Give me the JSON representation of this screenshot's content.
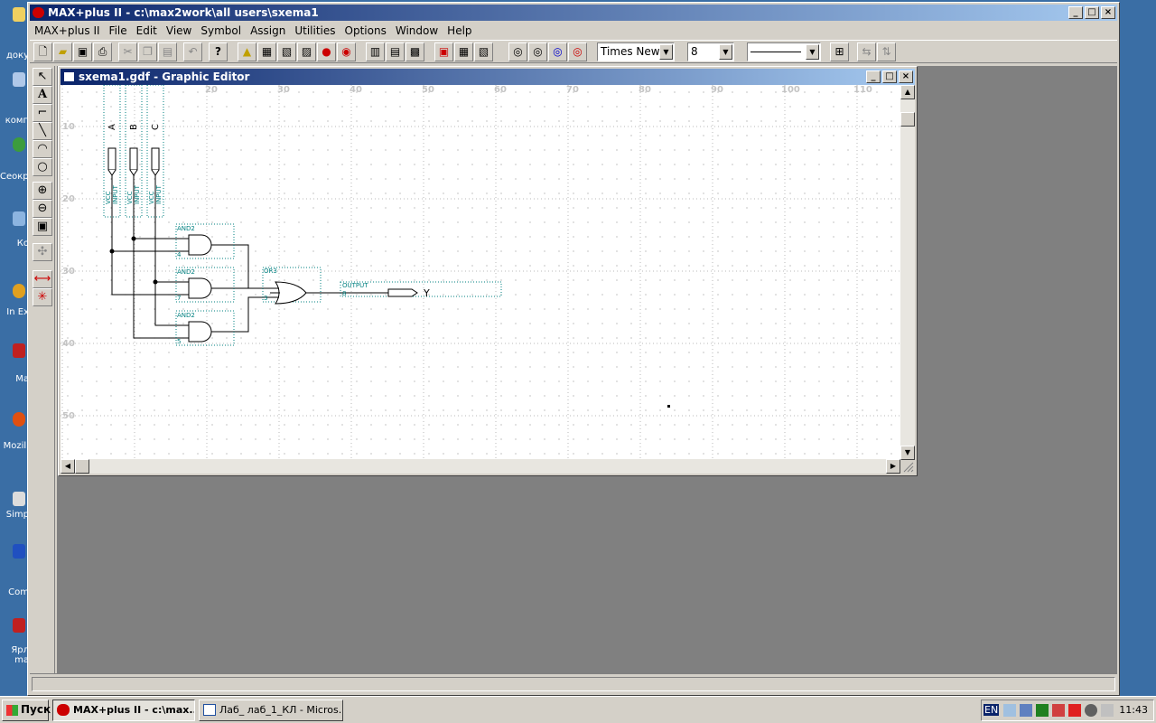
{
  "desktop": {
    "icons": [
      {
        "name": "my-documents",
        "label": "доку"
      },
      {
        "name": "my-computer",
        "label": "комп"
      },
      {
        "name": "network",
        "label": "Сеокрт"
      },
      {
        "name": "recycle",
        "label": "Ко"
      },
      {
        "name": "internet-explorer",
        "label": "In Ex"
      },
      {
        "name": "max",
        "label": "Ma"
      },
      {
        "name": "mozilla",
        "label": "Mozill"
      },
      {
        "name": "simp",
        "label": "Simp"
      },
      {
        "name": "total-commander",
        "label": "Com"
      },
      {
        "name": "shortcut",
        "label": "Ярл ma"
      }
    ]
  },
  "app": {
    "title": "MAX+plus II - c:\\max2work\\all users\\sxema1",
    "menu": [
      "MAX+plus II",
      "File",
      "Edit",
      "View",
      "Symbol",
      "Assign",
      "Utilities",
      "Options",
      "Window",
      "Help"
    ],
    "toolbar": {
      "font_name": "Times New",
      "font_size": "8"
    }
  },
  "child": {
    "title": "sxema1.gdf - Graphic Editor",
    "ruler_x": [
      "20",
      "30",
      "40",
      "50",
      "60",
      "70",
      "80",
      "90",
      "100",
      "110"
    ],
    "ruler_y": [
      "10",
      "20",
      "30",
      "40",
      "50"
    ]
  },
  "schematic": {
    "inputs": [
      {
        "name": "A",
        "prim": "INPUT",
        "vcc": "VCC"
      },
      {
        "name": "B",
        "prim": "INPUT",
        "vcc": "VCC"
      },
      {
        "name": "C",
        "prim": "INPUT",
        "vcc": "VCC"
      }
    ],
    "and_gates": [
      {
        "label": "AND2",
        "num": "4"
      },
      {
        "label": "AND2",
        "num": "7"
      },
      {
        "label": "AND2",
        "num": "5"
      }
    ],
    "or_gate": {
      "label": "OR3",
      "num": "3"
    },
    "output": {
      "prim": "OUTPUT",
      "num": "8",
      "name": "Y"
    }
  },
  "taskbar": {
    "start": "Пуск",
    "tasks": [
      {
        "label": "MAX+plus II - c:\\max...",
        "active": true
      },
      {
        "label": "Лаб_ лаб_1_КЛ - Micros...",
        "active": false
      }
    ],
    "lang": "EN",
    "clock": "11:43"
  },
  "colors": {
    "titlebar": "#0a246a",
    "face": "#d4d0c8",
    "mdi": "#808080",
    "desktop": "#3a6ea5",
    "teal": "#008080"
  }
}
